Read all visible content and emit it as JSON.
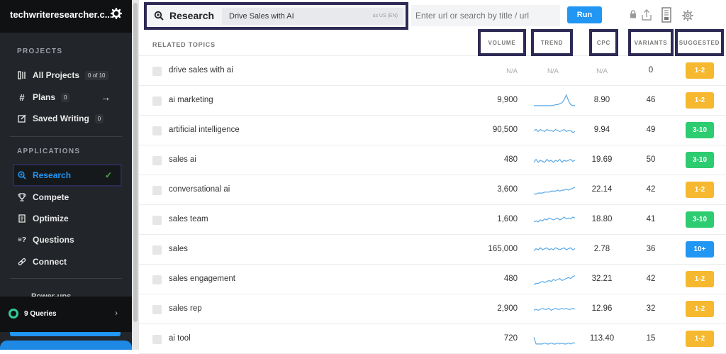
{
  "sidebar": {
    "workspace_name": "techwriteresearcher.c...",
    "projects_label": "PROJECTS",
    "applications_label": "APPLICATIONS",
    "projects": [
      {
        "label": "All Projects",
        "count": "0 of 10",
        "icon": "columns-icon"
      },
      {
        "label": "Plans",
        "count": "0",
        "icon": "hash-icon"
      },
      {
        "label": "Saved Writing",
        "count": "0",
        "icon": "edit-icon"
      }
    ],
    "applications": [
      {
        "label": "Research",
        "icon": "search-zoom-icon",
        "active": true
      },
      {
        "label": "Compete",
        "icon": "trophy-icon"
      },
      {
        "label": "Optimize",
        "icon": "document-icon"
      },
      {
        "label": "Questions",
        "icon": "question-icon"
      },
      {
        "label": "Connect",
        "icon": "link-icon"
      }
    ],
    "powerups_label": "Power-ups",
    "queries_label": "9 Queries"
  },
  "topbar": {
    "research_label": "Research",
    "topic": "Drive Sales with AI",
    "locale": "us  US (EN)",
    "url_placeholder": "Enter url or search by title / url",
    "run_label": "Run"
  },
  "table": {
    "headers": {
      "related": "RELATED TOPICS",
      "volume": "VOLUME",
      "trend": "TREND",
      "cpc": "CPC",
      "variants": "VARIANTS",
      "suggested": "SUGGESTED"
    },
    "rows": [
      {
        "keyword": "drive sales with ai",
        "volume": "N/A",
        "trend": "N/A",
        "cpc": "N/A",
        "variants": "0",
        "suggested": "1-2",
        "color": "#f5b82e",
        "spark": []
      },
      {
        "keyword": "ai marketing",
        "volume": "9,900",
        "trend": "",
        "cpc": "8.90",
        "variants": "46",
        "suggested": "1-2",
        "color": "#f5b82e",
        "spark": [
          3,
          3,
          3,
          3,
          3,
          3,
          3,
          3,
          3,
          3,
          4,
          4,
          5,
          6,
          9,
          14,
          8,
          4,
          3,
          3
        ]
      },
      {
        "keyword": "artificial intelligence",
        "volume": "90,500",
        "trend": "",
        "cpc": "9.94",
        "variants": "49",
        "suggested": "3-10",
        "color": "#2ecc71",
        "spark": [
          8,
          9,
          7,
          9,
          8,
          7,
          9,
          8,
          8,
          7,
          9,
          8,
          7,
          8,
          9,
          7,
          8,
          8,
          6,
          7
        ]
      },
      {
        "keyword": "sales ai",
        "volume": "480",
        "trend": "",
        "cpc": "19.69",
        "variants": "50",
        "suggested": "3-10",
        "color": "#2ecc71",
        "spark": [
          6,
          9,
          6,
          8,
          7,
          6,
          9,
          7,
          8,
          6,
          8,
          7,
          9,
          6,
          8,
          7,
          8,
          9,
          7,
          8
        ]
      },
      {
        "keyword": "conversational ai",
        "volume": "3,600",
        "trend": "",
        "cpc": "22.14",
        "variants": "42",
        "suggested": "1-2",
        "color": "#f5b82e",
        "spark": [
          4,
          4,
          5,
          5,
          5,
          6,
          6,
          6,
          7,
          7,
          7,
          8,
          7,
          8,
          8,
          9,
          8,
          9,
          10,
          11
        ]
      },
      {
        "keyword": "sales team",
        "volume": "1,600",
        "trend": "",
        "cpc": "18.80",
        "variants": "41",
        "suggested": "3-10",
        "color": "#2ecc71",
        "spark": [
          6,
          7,
          6,
          8,
          7,
          9,
          8,
          10,
          9,
          8,
          9,
          10,
          8,
          9,
          11,
          9,
          10,
          9,
          11,
          10
        ]
      },
      {
        "keyword": "sales",
        "volume": "165,000",
        "trend": "",
        "cpc": "2.78",
        "variants": "36",
        "suggested": "10+",
        "color": "#2196f3",
        "spark": [
          7,
          9,
          8,
          10,
          8,
          9,
          10,
          8,
          9,
          8,
          10,
          9,
          8,
          9,
          10,
          8,
          9,
          10,
          8,
          9
        ]
      },
      {
        "keyword": "sales engagement",
        "volume": "480",
        "trend": "",
        "cpc": "32.21",
        "variants": "42",
        "suggested": "1-2",
        "color": "#f5b82e",
        "spark": [
          3,
          4,
          4,
          5,
          6,
          5,
          6,
          7,
          6,
          8,
          7,
          8,
          9,
          7,
          8,
          9,
          10,
          9,
          11,
          12
        ]
      },
      {
        "keyword": "sales rep",
        "volume": "2,900",
        "trend": "",
        "cpc": "12.96",
        "variants": "32",
        "suggested": "1-2",
        "color": "#f5b82e",
        "spark": [
          7,
          8,
          7,
          8,
          9,
          8,
          8,
          9,
          7,
          8,
          9,
          8,
          8,
          9,
          8,
          9,
          8,
          8,
          9,
          8
        ]
      },
      {
        "keyword": "ai tool",
        "volume": "720",
        "trend": "",
        "cpc": "113.40",
        "variants": "15",
        "suggested": "1-2",
        "color": "#f5b82e",
        "spark": [
          10,
          3,
          3,
          3,
          3,
          4,
          3,
          3,
          4,
          3,
          3,
          4,
          3,
          4,
          3,
          3,
          4,
          3,
          4,
          4
        ]
      }
    ]
  },
  "colors": {
    "accent": "#2196f3",
    "highlight_border": "#2d2a55",
    "sidebar_bg": "#222529"
  }
}
